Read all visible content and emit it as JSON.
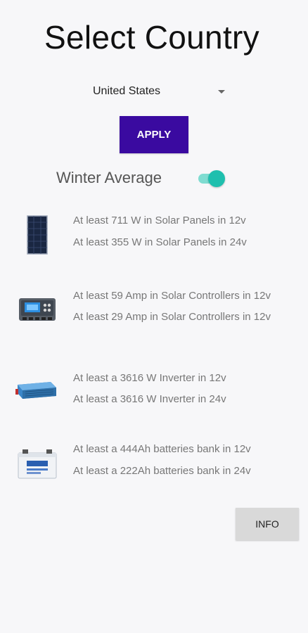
{
  "header": {
    "title": "Select Country"
  },
  "country": {
    "selected": "United States"
  },
  "apply_label": "APPLY",
  "season_toggle": {
    "label": "Winter Average",
    "on": true
  },
  "results": [
    {
      "icon": "solar-panel-icon",
      "lines": [
        "At least 711 W in Solar Panels in 12v",
        "At least 355 W in Solar Panels in 24v"
      ]
    },
    {
      "icon": "solar-controller-icon",
      "lines": [
        "At least 59 Amp in Solar Controllers in 12v",
        "At least 29 Amp in Solar Controllers in 12v"
      ]
    },
    {
      "icon": "inverter-icon",
      "lines": [
        "At least a 3616 W Inverter in 12v",
        "At least a 3616 W Inverter in 24v"
      ]
    },
    {
      "icon": "battery-icon",
      "lines": [
        "At least a 444Ah batteries bank in 12v",
        "At least a 222Ah batteries bank in 24v"
      ]
    }
  ],
  "info_label": "INFO",
  "colors": {
    "apply": "#3a0aa0",
    "toggle_thumb": "#1fbfae",
    "toggle_track": "#7fdcd1"
  }
}
